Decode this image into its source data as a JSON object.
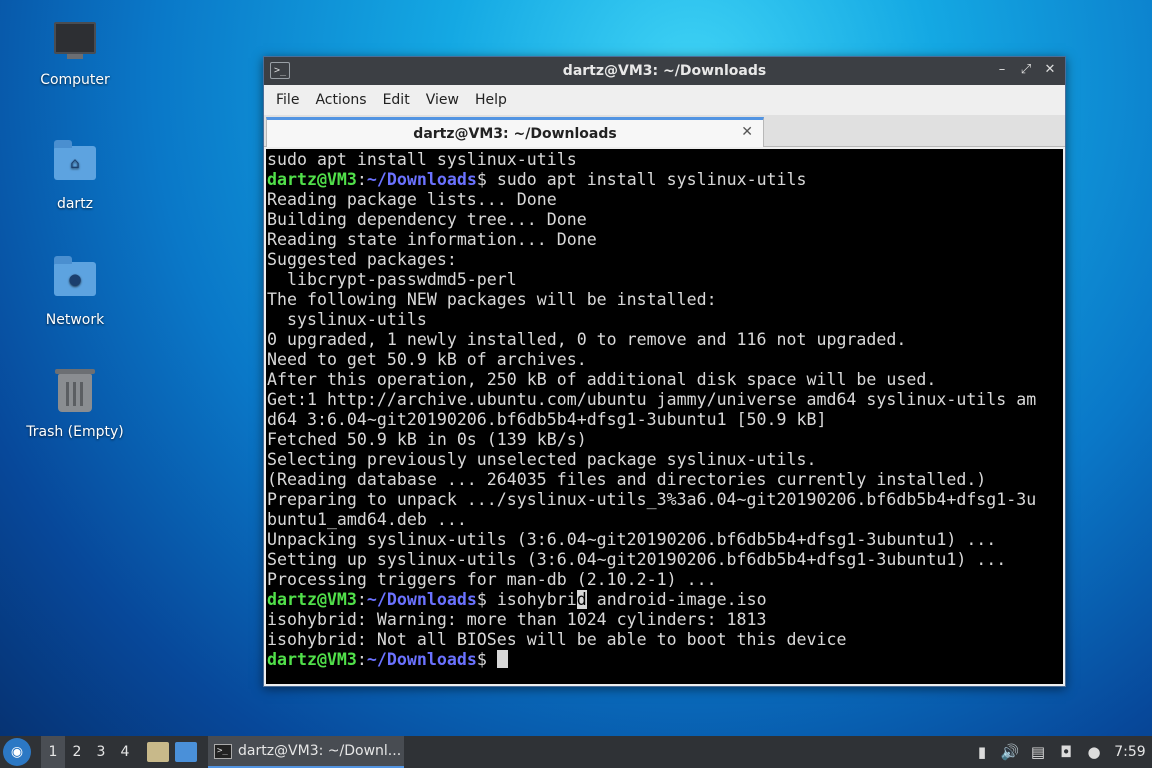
{
  "desktop": {
    "icons": [
      {
        "label": "Computer"
      },
      {
        "label": "dartz"
      },
      {
        "label": "Network"
      },
      {
        "label": "Trash (Empty)"
      }
    ]
  },
  "window": {
    "title": "dartz@VM3: ~/Downloads",
    "menu": [
      "File",
      "Actions",
      "Edit",
      "View",
      "Help"
    ],
    "tab_title": "dartz@VM3: ~/Downloads",
    "prompt_user": "dartz@VM3",
    "prompt_path": "~/Downloads",
    "terminal_lines": [
      "sudo apt install syslinux-utils",
      " sudo apt install syslinux-utils",
      "Reading package lists... Done",
      "Building dependency tree... Done",
      "Reading state information... Done",
      "Suggested packages:",
      "  libcrypt-passwdmd5-perl",
      "The following NEW packages will be installed:",
      "  syslinux-utils",
      "0 upgraded, 1 newly installed, 0 to remove and 116 not upgraded.",
      "Need to get 50.9 kB of archives.",
      "After this operation, 250 kB of additional disk space will be used.",
      "Get:1 http://archive.ubuntu.com/ubuntu jammy/universe amd64 syslinux-utils am",
      "d64 3:6.04~git20190206.bf6db5b4+dfsg1-3ubuntu1 [50.9 kB]",
      "Fetched 50.9 kB in 0s (139 kB/s)",
      "Selecting previously unselected package syslinux-utils.",
      "(Reading database ... 264035 files and directories currently installed.)",
      "Preparing to unpack .../syslinux-utils_3%3a6.04~git20190206.bf6db5b4+dfsg1-3u",
      "buntu1_amd64.deb ...",
      "Unpacking syslinux-utils (3:6.04~git20190206.bf6db5b4+dfsg1-3ubuntu1) ...",
      "Setting up syslinux-utils (3:6.04~git20190206.bf6db5b4+dfsg1-3ubuntu1) ...",
      "Processing triggers for man-db (2.10.2-1) ...",
      " isohybri",
      "d",
      " android-image.iso",
      "isohybrid: Warning: more than 1024 cylinders: 1813",
      "isohybrid: Not all BIOSes will be able to boot this device",
      " "
    ]
  },
  "taskbar": {
    "workspaces": [
      "1",
      "2",
      "3",
      "4"
    ],
    "task_title": "dartz@VM3: ~/Downl...",
    "clock": "7:59"
  }
}
